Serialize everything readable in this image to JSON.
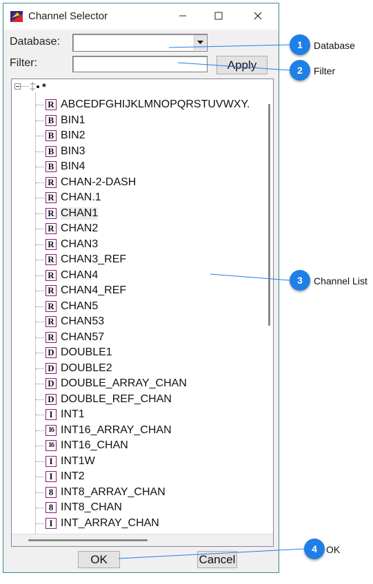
{
  "window": {
    "title": "Channel Selector",
    "minimize": "—",
    "maximize": "☐",
    "close": "✕"
  },
  "form": {
    "database_label": "Database:",
    "database_value": "",
    "filter_label": "Filter:",
    "filter_value": "",
    "apply": "Apply"
  },
  "tree": {
    "root": "*",
    "items": [
      {
        "badge": "R",
        "label": "ABCEDFGHIJKLMNOPQRSTUVWXY."
      },
      {
        "badge": "B",
        "label": "BIN1"
      },
      {
        "badge": "B",
        "label": "BIN2"
      },
      {
        "badge": "B",
        "label": "BIN3"
      },
      {
        "badge": "B",
        "label": "BIN4"
      },
      {
        "badge": "R",
        "label": "CHAN-2-DASH"
      },
      {
        "badge": "R",
        "label": "CHAN.1"
      },
      {
        "badge": "R",
        "label": "CHAN1"
      },
      {
        "badge": "R",
        "label": "CHAN2"
      },
      {
        "badge": "R",
        "label": "CHAN3"
      },
      {
        "badge": "R",
        "label": "CHAN3_REF"
      },
      {
        "badge": "R",
        "label": "CHAN4"
      },
      {
        "badge": "R",
        "label": "CHAN4_REF"
      },
      {
        "badge": "R",
        "label": "CHAN5"
      },
      {
        "badge": "R",
        "label": "CHAN53"
      },
      {
        "badge": "R",
        "label": "CHAN57"
      },
      {
        "badge": "D",
        "label": "DOUBLE1"
      },
      {
        "badge": "D",
        "label": "DOUBLE2"
      },
      {
        "badge": "D",
        "label": "DOUBLE_ARRAY_CHAN"
      },
      {
        "badge": "D",
        "label": "DOUBLE_REF_CHAN"
      },
      {
        "badge": "I",
        "label": "INT1"
      },
      {
        "badge": "16",
        "label": "INT16_ARRAY_CHAN"
      },
      {
        "badge": "16",
        "label": "INT16_CHAN"
      },
      {
        "badge": "I",
        "label": "INT1W"
      },
      {
        "badge": "I",
        "label": "INT2"
      },
      {
        "badge": "8",
        "label": "INT8_ARRAY_CHAN"
      },
      {
        "badge": "8",
        "label": "INT8_CHAN"
      },
      {
        "badge": "I",
        "label": "INT_ARRAY_CHAN"
      }
    ],
    "selected": "CHAN1"
  },
  "buttons": {
    "ok": "OK",
    "cancel": "Cancel"
  },
  "callouts": [
    {
      "num": "1",
      "label": "Database"
    },
    {
      "num": "2",
      "label": "Filter"
    },
    {
      "num": "3",
      "label": "Channel List"
    },
    {
      "num": "4",
      "label": "OK"
    }
  ],
  "colors": {
    "accent": "#1e7fe6",
    "border": "#2f8a8e",
    "badge_border": "#7a1f7a"
  }
}
